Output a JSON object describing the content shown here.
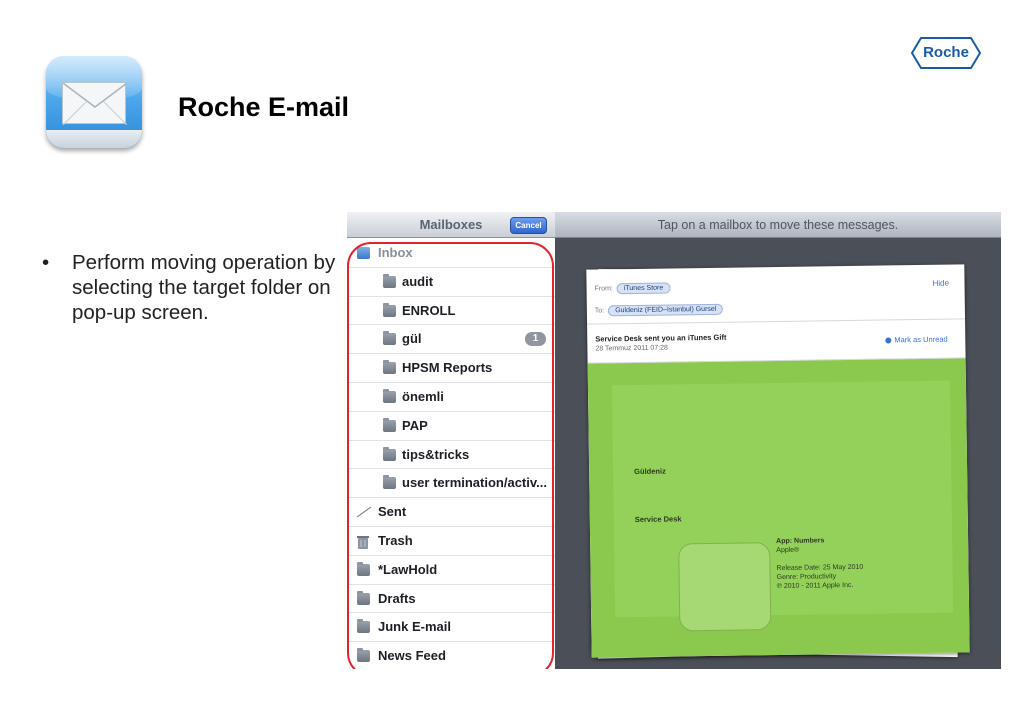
{
  "slide": {
    "title": "Roche E-mail",
    "logo_text": "Roche",
    "bullets": [
      "Perform moving operation by selecting the target folder on pop-up screen."
    ]
  },
  "mailboxes": {
    "title": "Mailboxes",
    "cancel_label": "Cancel",
    "items": [
      {
        "label": "Inbox",
        "icon": "inbox-icon"
      },
      {
        "label": "audit",
        "icon": "folder-icon"
      },
      {
        "label": "ENROLL",
        "icon": "folder-icon"
      },
      {
        "label": "gül",
        "icon": "folder-icon",
        "badge": "1"
      },
      {
        "label": "HPSM Reports",
        "icon": "folder-icon"
      },
      {
        "label": "önemli",
        "icon": "folder-icon"
      },
      {
        "label": "PAP",
        "icon": "folder-icon"
      },
      {
        "label": "tips&tricks",
        "icon": "folder-icon"
      },
      {
        "label": "user termination/activ...",
        "icon": "folder-icon"
      },
      {
        "label": "Sent",
        "icon": "sent-icon"
      },
      {
        "label": "Trash",
        "icon": "trash-icon"
      },
      {
        "label": "*LawHold",
        "icon": "folder-icon"
      },
      {
        "label": "Drafts",
        "icon": "folder-icon"
      },
      {
        "label": "Junk E-mail",
        "icon": "folder-icon"
      },
      {
        "label": "News Feed",
        "icon": "folder-icon"
      }
    ]
  },
  "message": {
    "prompt": "Tap on a mailbox to move these messages.",
    "from_label": "From:",
    "from": "iTunes Store",
    "to_label": "To:",
    "to": "Guldeniz (FEID–Istanbul) Gursel",
    "hide_label": "Hide",
    "subject": "Service Desk sent you an iTunes Gift",
    "date": "28 Temmuz 2011 07:28",
    "mark_unread": "Mark as Unread",
    "body_name": "Güldeniz",
    "body_sender": "Service Desk",
    "app_name": "App: Numbers",
    "app_vendor": "Apple®",
    "release_date": "Release Date: 25 May 2010",
    "genre": "Genre: Productivity",
    "copyright": "℗ 2010 - 2011 Apple Inc."
  },
  "colors": {
    "title_blue": "#1a5ba9",
    "highlight_red": "#e0232c",
    "email_green": "#8bc94e",
    "link_blue": "#3a6fd6"
  }
}
